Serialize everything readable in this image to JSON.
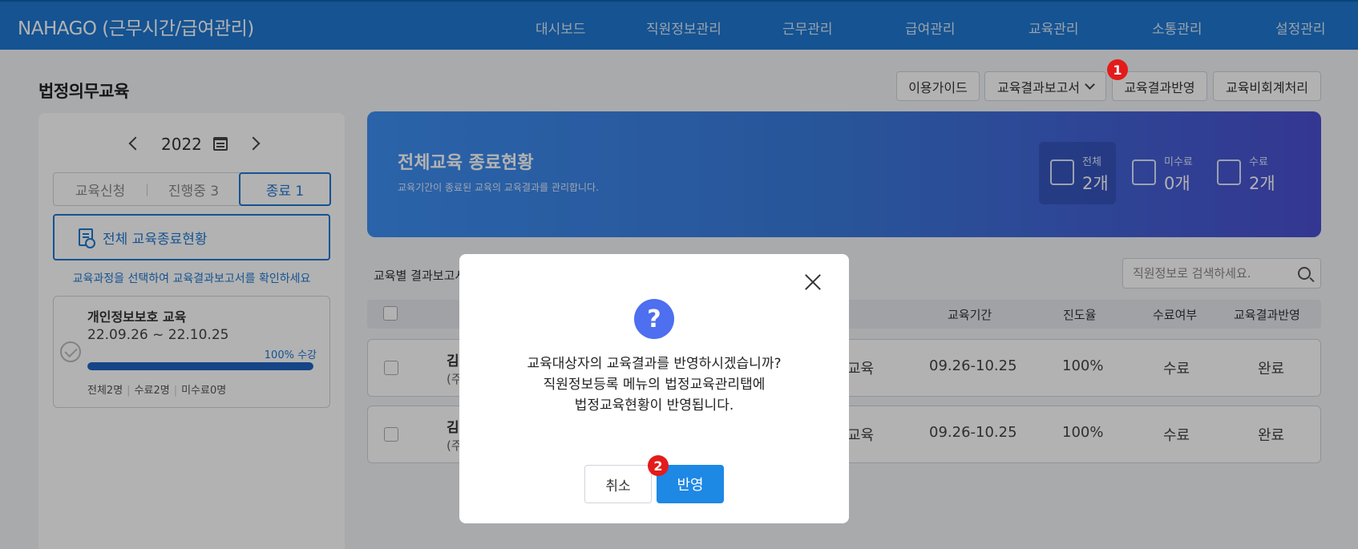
{
  "app": {
    "title": "NAHAGO (근무시간/급여관리)"
  },
  "nav": [
    {
      "label": "대시보드"
    },
    {
      "label": "직원정보관리"
    },
    {
      "label": "근무관리"
    },
    {
      "label": "급여관리"
    },
    {
      "label": "교육관리"
    },
    {
      "label": "소통관리"
    },
    {
      "label": "설정관리"
    }
  ],
  "page": {
    "title": "법정의무교육"
  },
  "toolbar": {
    "guide": "이용가이드",
    "report": "교육결과보고서",
    "reflect": "교육결과반영",
    "nonbill": "교육비회계처리"
  },
  "badges": {
    "first": "1",
    "second": "2"
  },
  "left": {
    "year": "2022",
    "tabs": [
      {
        "label": "교육신청"
      },
      {
        "label": "진행중 3"
      },
      {
        "label": "종료 1"
      }
    ],
    "all_button": "전체 교육종료현황",
    "hint": "교육과정을 선택하여 교육결과보고서를 확인하세요",
    "course": {
      "title": "개인정보보호 교육",
      "dates": "22.09.26 ~ 22.10.25",
      "progress_label": "100% 수강",
      "progress": 1.0,
      "count_total": "전체2명",
      "count_done": "수료2명",
      "count_undone": "미수료0명"
    }
  },
  "banner": {
    "title": "전체교육 종료현황",
    "subtitle": "교육기간이 종료된 교육의 교육결과를 관리합니다.",
    "stats": [
      {
        "label": "전체",
        "value": "2개"
      },
      {
        "label": "미수료",
        "value": "0개"
      },
      {
        "label": "수료",
        "value": "2개"
      }
    ]
  },
  "table": {
    "section_label": "교육별 결과보고서",
    "search_placeholder": "직원정보로 검색하세요.",
    "headers": {
      "period": "교육기간",
      "progress": "진도율",
      "complete": "수료여부",
      "reflect": "교육결과반영"
    },
    "rows": [
      {
        "name": "김",
        "sub": "(주",
        "course": "교육",
        "period": "09.26-10.25",
        "progress": "100%",
        "complete": "수료",
        "reflect": "완료"
      },
      {
        "name": "김",
        "sub": "(주",
        "course": "교육",
        "period": "09.26-10.25",
        "progress": "100%",
        "complete": "수료",
        "reflect": "완료"
      }
    ]
  },
  "modal": {
    "icon": "?",
    "message_line1": "교육대상자의 교육결과를 반영하시겠습니까?",
    "message_line2": "직원정보등록 메뉴의 법정교육관리탭에",
    "message_line3": "법정교육현황이 반영됩니다.",
    "cancel": "취소",
    "confirm": "반영"
  },
  "colors": {
    "primary": "#1f78d1",
    "badge": "#e31b1b",
    "confirm": "#1e88e5"
  }
}
